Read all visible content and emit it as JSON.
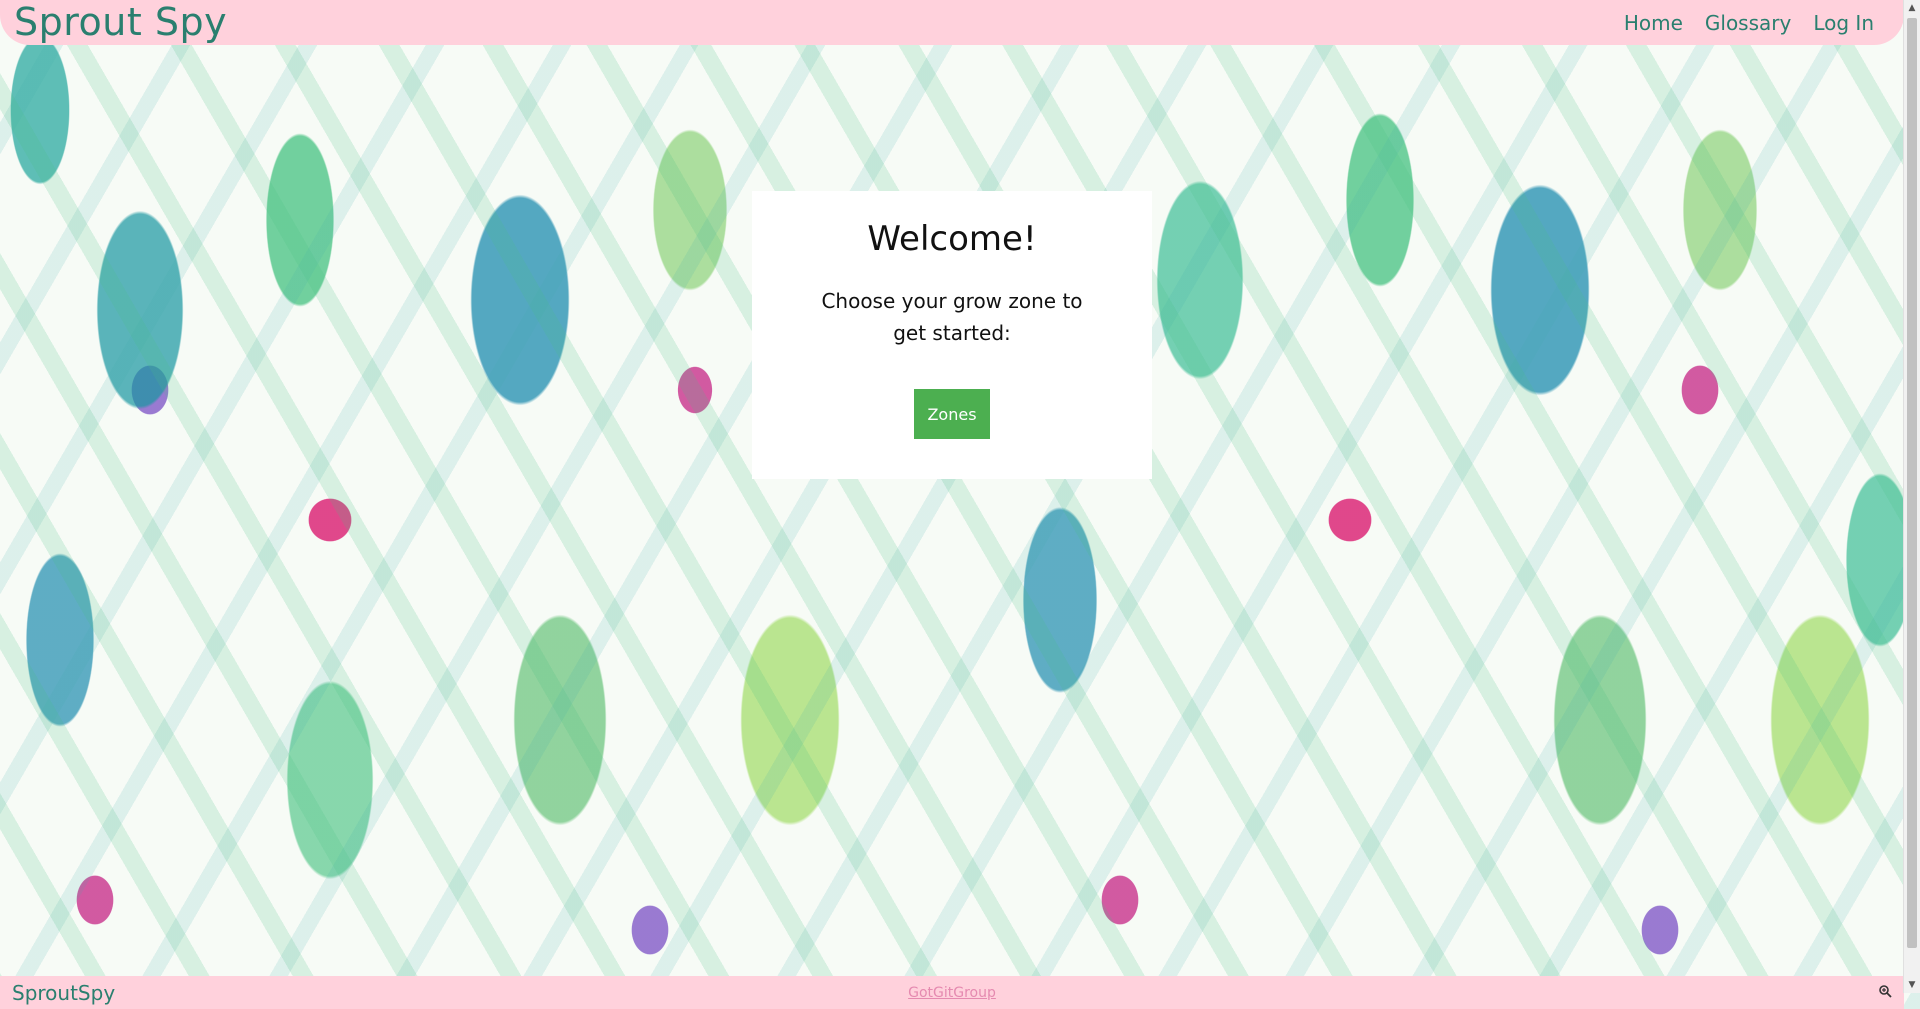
{
  "navbar": {
    "brand": "Sprout Spy",
    "links": [
      {
        "label": "Home"
      },
      {
        "label": "Glossary"
      },
      {
        "label": "Log In"
      }
    ]
  },
  "card": {
    "title": "Welcome!",
    "text": "Choose your grow zone to get started:",
    "button_label": "Zones"
  },
  "footer": {
    "brand": "SproutSpy",
    "link_label": "GotGitGroup"
  },
  "icons": {
    "zoom": "zoom-icon",
    "scroll_up": "chevron-up-icon",
    "scroll_down": "chevron-down-icon"
  },
  "colors": {
    "nav_pink": "#ffd1dc",
    "brand_green": "#2a7f6f",
    "button_green": "#4caf50",
    "footer_link_pink": "#e58ab0"
  }
}
